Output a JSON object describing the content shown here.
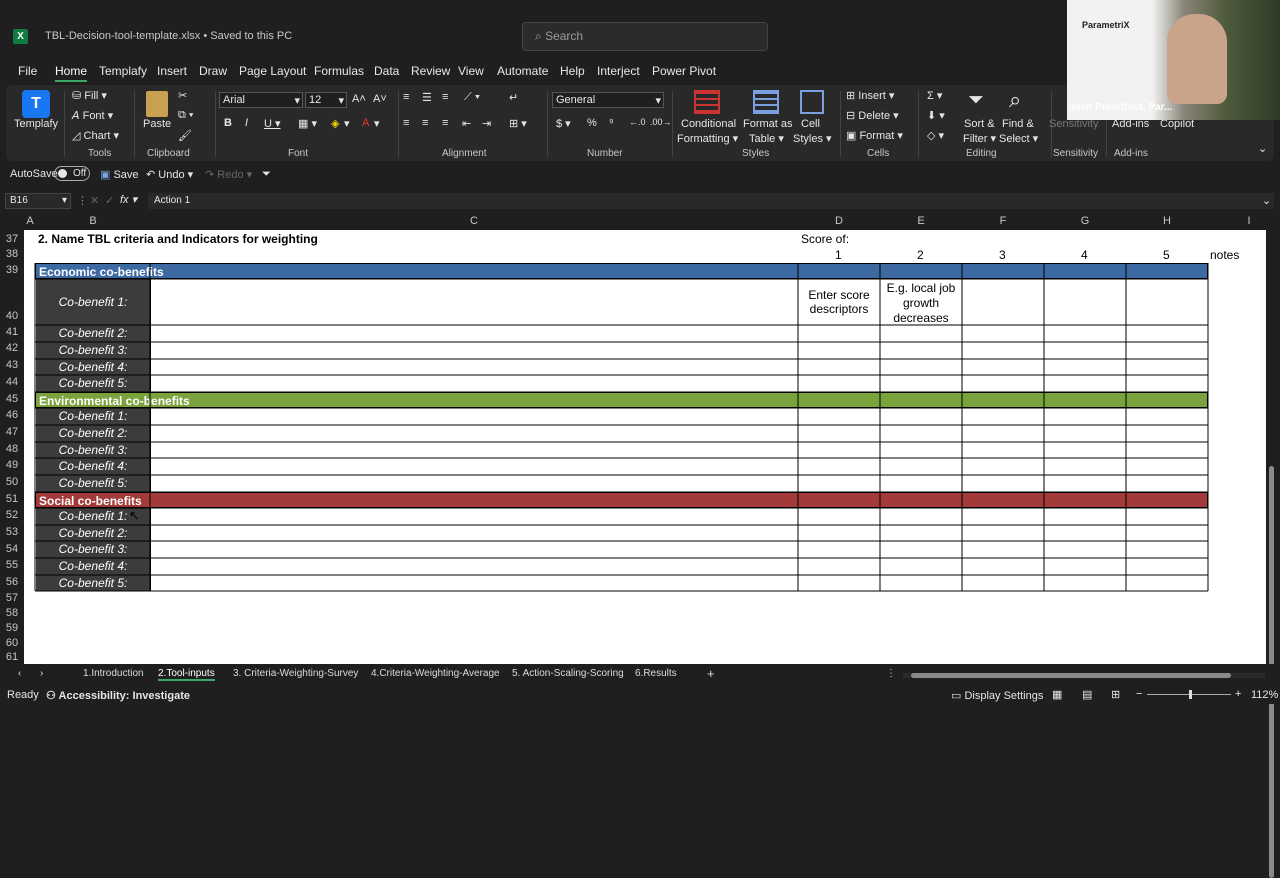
{
  "app": {
    "file_title": "TBL-Decision-tool-template.xlsx • Saved to this PC",
    "search_placeholder": "Search"
  },
  "menu": [
    "File",
    "Home",
    "Templafy",
    "Insert",
    "Draw",
    "Page Layout",
    "Formulas",
    "Data",
    "Review",
    "View",
    "Automate",
    "Help",
    "Interject",
    "Power Pivot"
  ],
  "ribbon": {
    "templafy": "Templafy",
    "fill": "Fill",
    "font_btn": "Font",
    "chart": "Chart",
    "tools": "Tools",
    "paste": "Paste",
    "clipboard": "Clipboard",
    "font_name": "Arial",
    "font_size": "12",
    "font_group": "Font",
    "alignment": "Alignment",
    "number_format": "General",
    "number": "Number",
    "conditional": "Conditional",
    "formatting": "Formatting",
    "format_as": "Format as",
    "table": "Table",
    "cell": "Cell",
    "styles_btn": "Styles",
    "styles": "Styles",
    "insert": "Insert",
    "delete": "Delete",
    "format": "Format",
    "cells": "Cells",
    "sort": "Sort &",
    "filter": "Filter",
    "find": "Find &",
    "select": "Select",
    "editing": "Editing",
    "sensitivity": "Sensitivity",
    "addins": "Add-ins",
    "copilot": "Copilot",
    "addins_grp": "Add-ins"
  },
  "qat": {
    "autosave": "AutoSave",
    "toggle": "Off",
    "save": "Save",
    "undo": "Undo",
    "redo": "Redo"
  },
  "formula_bar": {
    "name_box": "B16",
    "formula": "Action 1"
  },
  "columns": [
    "A",
    "B",
    "C",
    "D",
    "E",
    "F",
    "G",
    "H",
    "I"
  ],
  "rows": [
    "37",
    "38",
    "39",
    "40",
    "41",
    "42",
    "43",
    "44",
    "45",
    "46",
    "47",
    "48",
    "49",
    "50",
    "51",
    "52",
    "53",
    "54",
    "55",
    "56",
    "57",
    "58",
    "59",
    "60",
    "61"
  ],
  "sheet": {
    "heading": "2.  Name TBL criteria and Indicators  for weighting",
    "score_of": "Score of:",
    "scores": [
      "1",
      "2",
      "3",
      "4",
      "5"
    ],
    "notes": "notes",
    "sections": [
      {
        "title": "Economic co-benefits",
        "color": "#3d6aa3"
      },
      {
        "title": "Environmental co-benefits",
        "color": "#7aa33e"
      },
      {
        "title": "Social co-benefits",
        "color": "#a33a3a"
      }
    ],
    "cobenefits": [
      "Co-benefit 1:",
      "Co-benefit 2:",
      "Co-benefit 3:",
      "Co-benefit 4:",
      "Co-benefit 5:"
    ],
    "d40": "Enter score descriptors",
    "e40": "E.g. local job growth decreases"
  },
  "tabs": [
    "1.Introduction",
    "2.Tool-inputs",
    "3. Criteria-Weighting-Survey",
    "4.Criteria-Weighting-Average",
    "5. Action-Scaling-Scoring",
    "6.Results"
  ],
  "status": {
    "ready": "Ready",
    "accessibility": "Accessibility: Investigate",
    "display": "Display Settings",
    "zoom": "112%"
  },
  "video": {
    "brand": "ParametriX",
    "name": "Josh Proudfoot, Par..."
  }
}
